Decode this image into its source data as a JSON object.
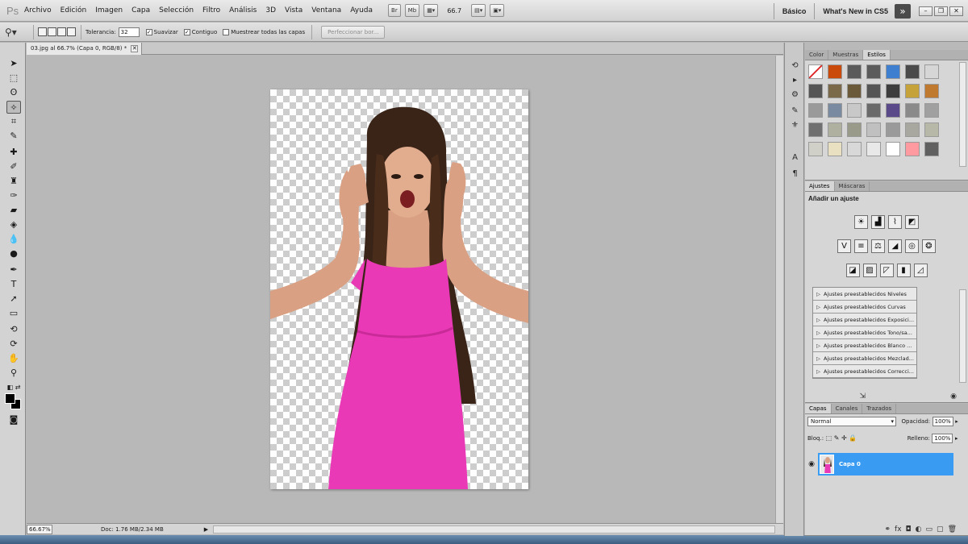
{
  "app": {
    "logo_text": "Ps"
  },
  "menu": [
    "Archivo",
    "Edición",
    "Imagen",
    "Capa",
    "Selección",
    "Filtro",
    "Análisis",
    "3D",
    "Vista",
    "Ventana",
    "Ayuda"
  ],
  "menubar_buttons": {
    "bridge": "Br",
    "mini_bridge": "Mb",
    "zoom_value": "66.7"
  },
  "workspace": {
    "basic": "Básico",
    "whats_new": "What's New in CS5",
    "arrow": "»"
  },
  "options": {
    "tolerance_label": "Tolerancia:",
    "tolerance_value": "32",
    "antialias_label": "Suavizar",
    "contiguous_label": "Contiguo",
    "sample_all_label": "Muestrear todas las capas",
    "refine_button": "Perfeccionar bor..."
  },
  "document": {
    "tab_title": "03.jpg al 66.7% (Capa 0, RGB/8) *",
    "zoom": "66.67%",
    "doc_info": "Doc: 1.76 MB/2.34 MB"
  },
  "styles_panel": {
    "tabs": [
      "Color",
      "Muestras",
      "Estilos"
    ],
    "active_tab": "Estilos",
    "swatches": [
      "#d94040",
      "#c94a0b",
      "#5a5a5a",
      "#5b5b5b",
      "#3f7fcf",
      "#4a4a4a",
      "#d6d6d6",
      "#555555",
      "#7a6a4a",
      "#6b5a3a",
      "#555555",
      "#3d3d3d",
      "#c6a23a",
      "#bf7a2f",
      "#9a9a9a",
      "#7a8aa0",
      "#c8c8c8",
      "#6a6a6a",
      "#5a4a8a",
      "#8a8a8a",
      "#a0a0a0",
      "#707070",
      "#b0b0a0",
      "#9a9a8a",
      "#c0c0c0",
      "#9a9a9a",
      "#a8a8a0",
      "#b8b8a8",
      "#d0d0c8",
      "#e8e0c0",
      "#d8d8d8",
      "#e8e8e8",
      "#ffffff",
      "#ff9aa0",
      "#606060",
      "#f0f0f0"
    ]
  },
  "adjustments_panel": {
    "tabs": [
      "Ajustes",
      "Máscaras"
    ],
    "active_tab": "Ajustes",
    "title": "Añadir un ajuste",
    "presets": [
      "Ajustes preestablecidos Niveles",
      "Ajustes preestablecidos Curvas",
      "Ajustes preestablecidos Exposici...",
      "Ajustes preestablecidos Tono/sa...",
      "Ajustes preestablecidos Blanco ...",
      "Ajustes preestablecidos Mezclad...",
      "Ajustes preestablecidos Correcci..."
    ]
  },
  "layers_panel": {
    "tabs": [
      "Capas",
      "Canales",
      "Trazados"
    ],
    "active_tab": "Capas",
    "blend_mode": "Normal",
    "opacity_label": "Opacidad:",
    "opacity_value": "100%",
    "lock_label": "Bloq.:",
    "fill_label": "Relleno:",
    "fill_value": "100%",
    "layer_name": "Capa 0",
    "selection_color": "#3a9bf2"
  }
}
